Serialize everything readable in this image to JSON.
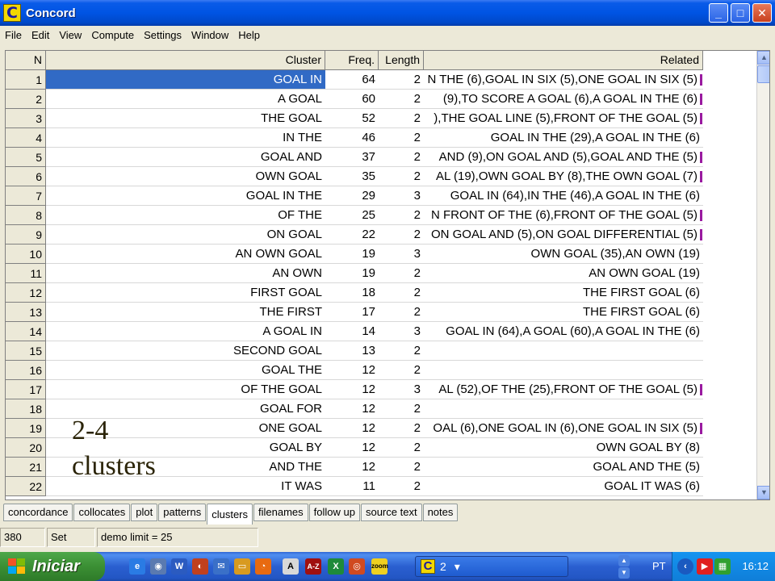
{
  "window": {
    "title": "Concord"
  },
  "menu": [
    "File",
    "Edit",
    "View",
    "Compute",
    "Settings",
    "Window",
    "Help"
  ],
  "grid": {
    "columns": [
      "N",
      "Cluster",
      "Freq.",
      "Length",
      "Related"
    ],
    "rows": [
      {
        "n": "1",
        "cluster": "GOAL IN",
        "freq": "64",
        "len": "2",
        "related": "N THE (6),GOAL IN SIX (5),ONE GOAL IN SIX (5)",
        "trunc": true,
        "selected": true
      },
      {
        "n": "2",
        "cluster": "A GOAL",
        "freq": "60",
        "len": "2",
        "related": "(9),TO SCORE A GOAL (6),A GOAL IN THE (6)",
        "trunc": true
      },
      {
        "n": "3",
        "cluster": "THE GOAL",
        "freq": "52",
        "len": "2",
        "related": "),THE GOAL LINE (5),FRONT OF THE GOAL (5)",
        "trunc": true
      },
      {
        "n": "4",
        "cluster": "IN THE",
        "freq": "46",
        "len": "2",
        "related": "GOAL IN THE (29),A GOAL IN THE (6)",
        "trunc": false
      },
      {
        "n": "5",
        "cluster": "GOAL AND",
        "freq": "37",
        "len": "2",
        "related": "AND (9),ON GOAL AND (5),GOAL AND THE (5)",
        "trunc": true
      },
      {
        "n": "6",
        "cluster": "OWN GOAL",
        "freq": "35",
        "len": "2",
        "related": "AL (19),OWN GOAL BY (8),THE OWN GOAL (7)",
        "trunc": true
      },
      {
        "n": "7",
        "cluster": "GOAL IN THE",
        "freq": "29",
        "len": "3",
        "related": "GOAL IN (64),IN THE (46),A GOAL IN THE (6)",
        "trunc": false
      },
      {
        "n": "8",
        "cluster": "OF THE",
        "freq": "25",
        "len": "2",
        "related": "N FRONT OF THE (6),FRONT OF THE GOAL (5)",
        "trunc": true
      },
      {
        "n": "9",
        "cluster": "ON GOAL",
        "freq": "22",
        "len": "2",
        "related": "ON GOAL AND (5),ON GOAL DIFFERENTIAL (5)",
        "trunc": true
      },
      {
        "n": "10",
        "cluster": "AN OWN GOAL",
        "freq": "19",
        "len": "3",
        "related": "OWN GOAL (35),AN OWN (19)",
        "trunc": false
      },
      {
        "n": "11",
        "cluster": "AN OWN",
        "freq": "19",
        "len": "2",
        "related": "AN OWN GOAL (19)",
        "trunc": false
      },
      {
        "n": "12",
        "cluster": "FIRST GOAL",
        "freq": "18",
        "len": "2",
        "related": "THE FIRST GOAL (6)",
        "trunc": false
      },
      {
        "n": "13",
        "cluster": "THE FIRST",
        "freq": "17",
        "len": "2",
        "related": "THE FIRST GOAL (6)",
        "trunc": false
      },
      {
        "n": "14",
        "cluster": "A GOAL IN",
        "freq": "14",
        "len": "3",
        "related": "GOAL IN (64),A GOAL (60),A GOAL IN THE (6)",
        "trunc": false
      },
      {
        "n": "15",
        "cluster": "SECOND GOAL",
        "freq": "13",
        "len": "2",
        "related": "",
        "trunc": false
      },
      {
        "n": "16",
        "cluster": "GOAL THE",
        "freq": "12",
        "len": "2",
        "related": "",
        "trunc": false
      },
      {
        "n": "17",
        "cluster": "OF THE GOAL",
        "freq": "12",
        "len": "3",
        "related": "AL (52),OF THE (25),FRONT OF THE GOAL (5)",
        "trunc": true
      },
      {
        "n": "18",
        "cluster": "GOAL FOR",
        "freq": "12",
        "len": "2",
        "related": "",
        "trunc": false
      },
      {
        "n": "19",
        "cluster": "ONE GOAL",
        "freq": "12",
        "len": "2",
        "related": "OAL (6),ONE GOAL IN (6),ONE GOAL IN SIX (5)",
        "trunc": true
      },
      {
        "n": "20",
        "cluster": "GOAL BY",
        "freq": "12",
        "len": "2",
        "related": "OWN GOAL BY (8)",
        "trunc": false
      },
      {
        "n": "21",
        "cluster": "AND THE",
        "freq": "12",
        "len": "2",
        "related": "GOAL AND THE (5)",
        "trunc": false
      },
      {
        "n": "22",
        "cluster": "IT WAS",
        "freq": "11",
        "len": "2",
        "related": "GOAL IT WAS (6)",
        "trunc": false
      }
    ]
  },
  "overlay": {
    "line1": "2-4",
    "line2": "clusters"
  },
  "tabs": [
    {
      "label": "concordance"
    },
    {
      "label": "collocates"
    },
    {
      "label": "plot"
    },
    {
      "label": "patterns"
    },
    {
      "label": "clusters",
      "active": true
    },
    {
      "label": "filenames"
    },
    {
      "label": "follow up"
    },
    {
      "label": "source text"
    },
    {
      "label": "notes"
    }
  ],
  "status": {
    "count": "380",
    "mode": "Set",
    "limit": "demo limit = 25"
  },
  "taskbar": {
    "start_label": "Iniciar",
    "task_count": "2",
    "lang": "PT",
    "clock": "16:12"
  },
  "colors": {
    "selection": "#316ac5",
    "truncation_marker": "#9a1aa0"
  }
}
